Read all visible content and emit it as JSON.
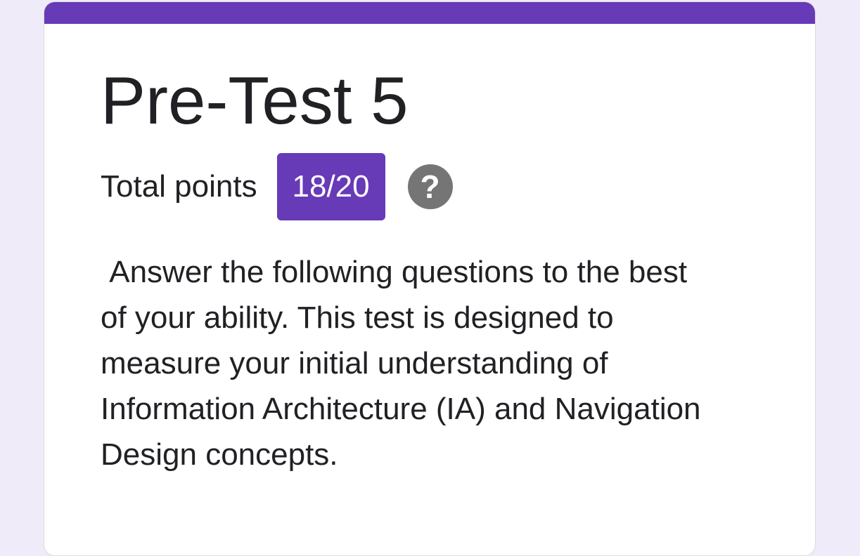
{
  "form": {
    "title": "Pre-Test 5",
    "total_points_label": "Total points",
    "score": "18/20",
    "help_icon_glyph": "?",
    "description": " Answer the following questions to the best\nof your ability. This test is designed to\nmeasure your initial understanding of\nInformation Architecture (IA) and Navigation\nDesign concepts."
  },
  "colors": {
    "accent": "#673ab7",
    "page_background": "#f0ebf8",
    "card_background": "#ffffff",
    "help_icon": "#757575",
    "text": "#202124"
  },
  "icons": {
    "help": "question-mark-circle-icon"
  }
}
